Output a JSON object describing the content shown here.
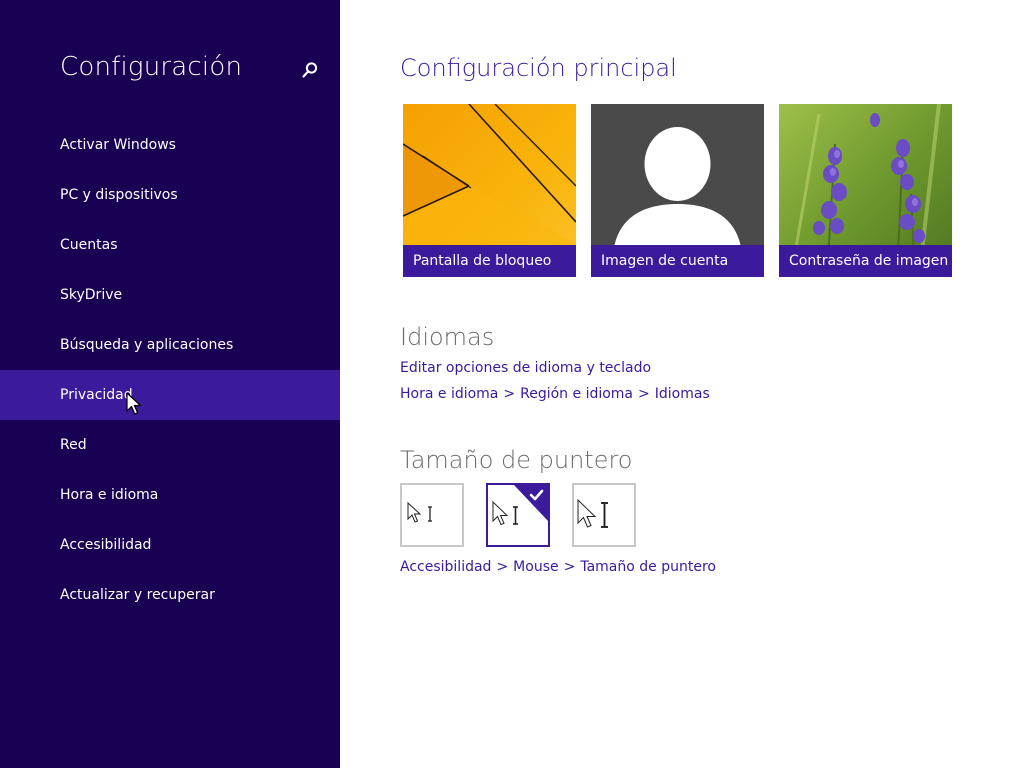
{
  "sidebar": {
    "title": "Configuración",
    "search_icon": "search-icon",
    "items": [
      {
        "label": "Activar Windows"
      },
      {
        "label": "PC y dispositivos"
      },
      {
        "label": "Cuentas"
      },
      {
        "label": "SkyDrive"
      },
      {
        "label": "Búsqueda y aplicaciones"
      },
      {
        "label": "Privacidad",
        "selected": true
      },
      {
        "label": "Red"
      },
      {
        "label": "Hora e idioma"
      },
      {
        "label": "Accesibilidad"
      },
      {
        "label": "Actualizar y recuperar"
      }
    ]
  },
  "main": {
    "title": "Configuración principal",
    "tiles": [
      {
        "label": "Pantalla de bloqueo",
        "image": "orange-abstract-wallpaper"
      },
      {
        "label": "Imagen de cuenta",
        "image": "default-user-avatar"
      },
      {
        "label": "Contraseña de imagen",
        "image": "lavender-flowers-photo"
      }
    ],
    "languages": {
      "heading": "Idiomas",
      "link": "Editar opciones de idioma y teclado",
      "breadcrumb": [
        "Hora e idioma",
        "Región e idioma",
        "Idiomas"
      ]
    },
    "pointer": {
      "heading": "Tamaño de puntero",
      "options": [
        {
          "size": "small"
        },
        {
          "size": "medium",
          "selected": true
        },
        {
          "size": "large"
        }
      ],
      "breadcrumb": [
        "Accesibilidad",
        "Mouse",
        "Tamaño de puntero"
      ]
    },
    "breadcrumb_separator": ">"
  },
  "colors": {
    "sidebar_bg": "#180052",
    "selected_bg": "#3c1a9c",
    "accent": "#3a1a9c"
  }
}
